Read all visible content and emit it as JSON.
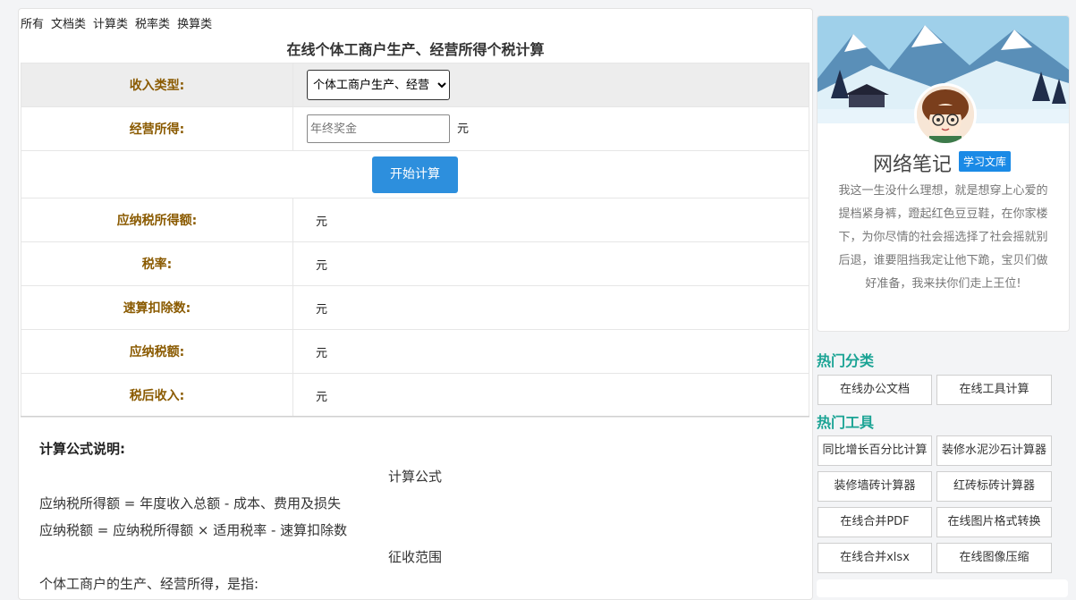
{
  "nav": [
    "所有",
    "文档类",
    "计算类",
    "税率类",
    "换算类"
  ],
  "page_title": "在线个体工商户生产、经营所得个税计算",
  "form": {
    "income_type_label": "收入类型:",
    "income_type_value": "个体工商户生产、经营所得",
    "income_type_display": "个体工商户生产、经营",
    "profit_label": "经营所得:",
    "profit_placeholder": "年终奖金",
    "unit": "元",
    "calc_button": "开始计算"
  },
  "results": [
    {
      "label": "应纳税所得额:",
      "unit": "元"
    },
    {
      "label": "税率:",
      "unit": "元"
    },
    {
      "label": "速算扣除数:",
      "unit": "元"
    },
    {
      "label": "应纳税额:",
      "unit": "元"
    },
    {
      "label": "税后收入:",
      "unit": "元"
    }
  ],
  "description": {
    "heading": "计算公式说明:",
    "formula_title": "计算公式",
    "formula_line1": "应纳税所得额 = 年度收入总额 - 成本、费用及损失",
    "formula_line2": "应纳税额 = 应纳税所得额 × 适用税率 - 速算扣除数",
    "scope_title": "征收范围",
    "scope_line1": "个体工商户的生产、经营所得，是指:"
  },
  "sidebar": {
    "site_name": "网络笔记",
    "badge": "学习文库",
    "motto": "我这一生没什么理想，就是想穿上心爱的提档紧身裤，蹬起红色豆豆鞋，在你家楼下，为你尽情的社会摇选择了社会摇就别后退，谁要阻挡我定让他下跪，宝贝们做好准备，我来扶你们走上王位!",
    "hot_categories_title": "热门分类",
    "hot_categories": [
      "在线办公文档",
      "在线工具计算"
    ],
    "hot_tools_title": "热门工具",
    "hot_tools": [
      "同比增长百分比计算",
      "装修水泥沙石计算器",
      "装修墙砖计算器",
      "红砖标砖计算器",
      "在线合并PDF",
      "在线图片格式转换",
      "在线合并xlsx",
      "在线图像压缩"
    ]
  },
  "colors": {
    "label_text": "#8a5a00",
    "button_blue": "#2d8fdd",
    "section_title": "#1aa394",
    "badge_blue": "#1a8ae6"
  }
}
